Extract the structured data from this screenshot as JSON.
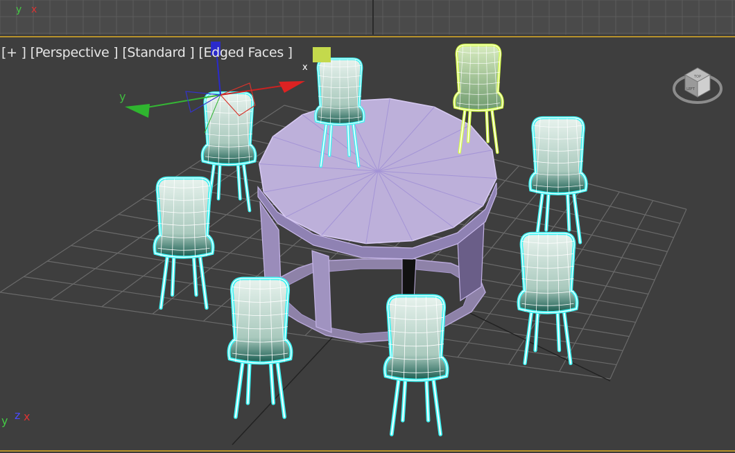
{
  "viewport": {
    "labels": {
      "plus": "[+ ]",
      "view": "[Perspective ]",
      "shading": "[Standard ]",
      "mode": "[Edged Faces ]"
    },
    "selection_color": "#c4d94c"
  },
  "gizmo": {
    "x": "x",
    "y": "y"
  },
  "corner_axes": {
    "x": "x",
    "y": "y",
    "z": "z"
  },
  "top_axes": {
    "x": "x",
    "y": "y"
  },
  "viewcube": {
    "face_top": "TOP",
    "face_left": "LEFT"
  },
  "colors": {
    "selected_wire": "#d8ff4a",
    "object_wire": "#3ff4f4",
    "table": "#bfb0dc",
    "grid": "#6a6a6a",
    "viewport_border": "#b8932c"
  }
}
